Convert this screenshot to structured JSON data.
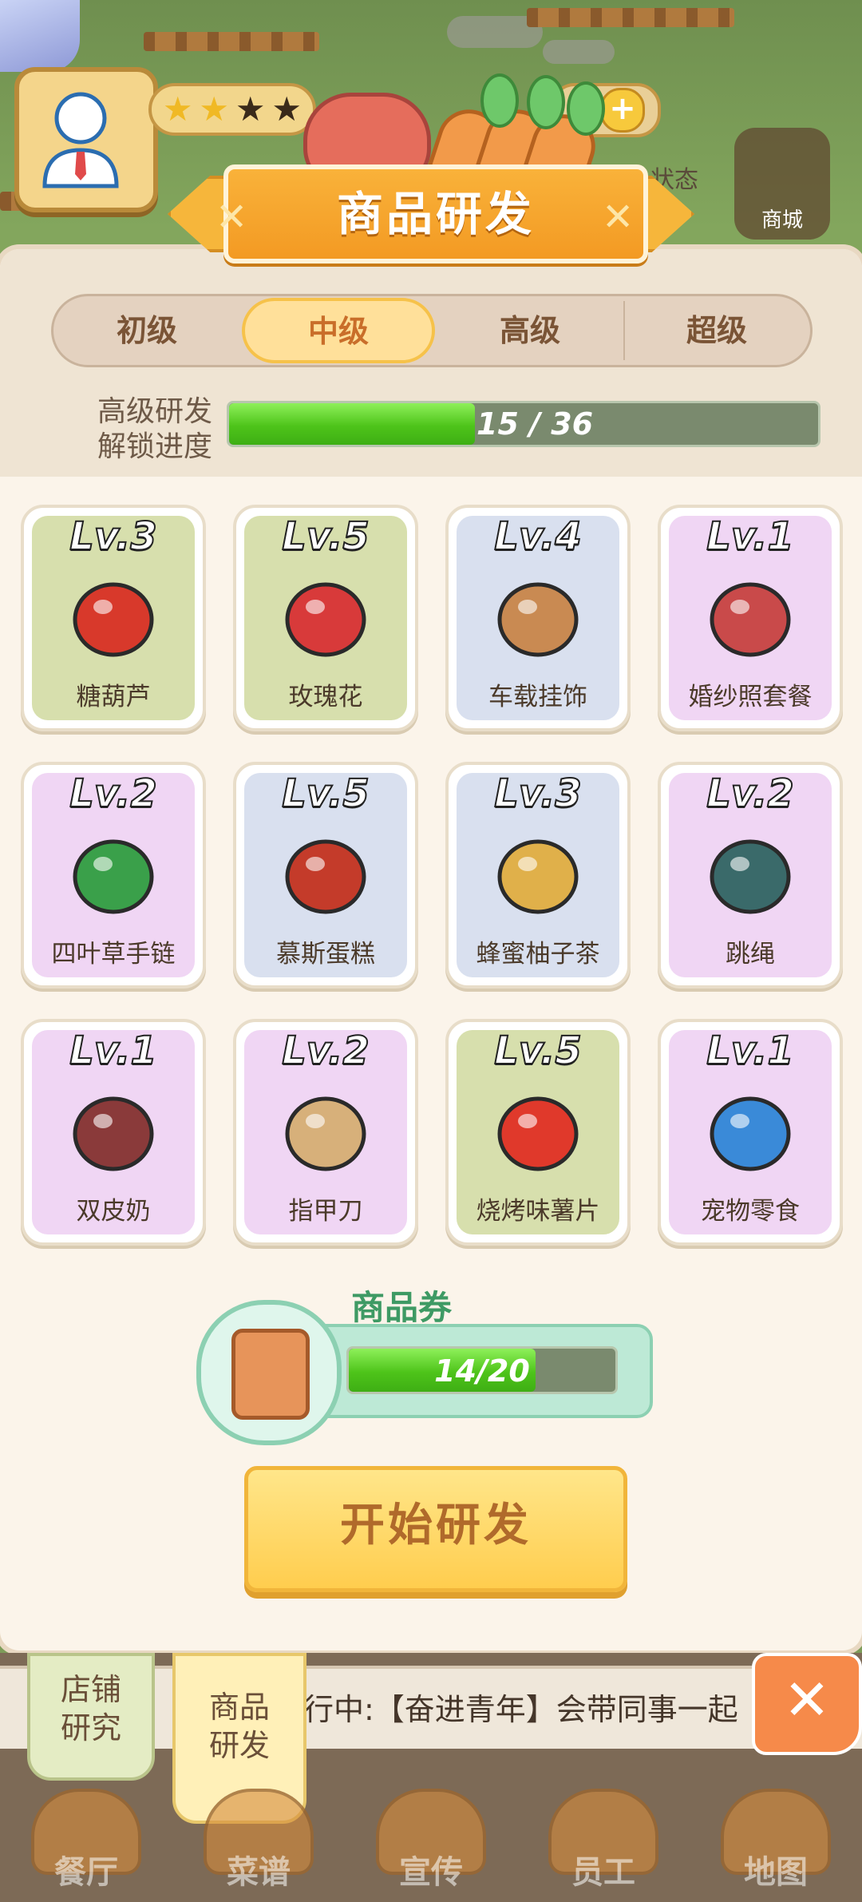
{
  "header": {
    "stars": [
      "★",
      "★",
      "★",
      "★"
    ],
    "shop_label": "商城",
    "status_text": "状态"
  },
  "panel": {
    "title": "商品研发",
    "tabs": [
      {
        "label": "初级",
        "active": false
      },
      {
        "label": "中级",
        "active": true
      },
      {
        "label": "高级",
        "active": false
      },
      {
        "label": "超级",
        "active": false
      }
    ],
    "unlock": {
      "label_line1": "高级研发",
      "label_line2": "解锁进度",
      "current": 15,
      "total": 36,
      "text": "15 / 36"
    },
    "items": [
      {
        "level": "Lv.3",
        "name": "糖葫芦",
        "theme": "green"
      },
      {
        "level": "Lv.5",
        "name": "玫瑰花",
        "theme": "green"
      },
      {
        "level": "Lv.4",
        "name": "车载挂饰",
        "theme": "blue"
      },
      {
        "level": "Lv.1",
        "name": "婚纱照套餐",
        "theme": "purple"
      },
      {
        "level": "Lv.2",
        "name": "四叶草手链",
        "theme": "purple"
      },
      {
        "level": "Lv.5",
        "name": "慕斯蛋糕",
        "theme": "blue"
      },
      {
        "level": "Lv.3",
        "name": "蜂蜜柚子茶",
        "theme": "blue"
      },
      {
        "level": "Lv.2",
        "name": "跳绳",
        "theme": "purple"
      },
      {
        "level": "Lv.1",
        "name": "双皮奶",
        "theme": "purple"
      },
      {
        "level": "Lv.2",
        "name": "指甲刀",
        "theme": "purple"
      },
      {
        "level": "Lv.5",
        "name": "烧烤味薯片",
        "theme": "green"
      },
      {
        "level": "Lv.1",
        "name": "宠物零食",
        "theme": "purple"
      }
    ],
    "voucher": {
      "title": "商品券",
      "current": 14,
      "total": 20,
      "text": "14/20"
    },
    "start_button": "开始研发"
  },
  "bottom": {
    "side_tabs": [
      {
        "line1": "店铺",
        "line2": "研究"
      },
      {
        "line1": "商品",
        "line2": "研发"
      }
    ],
    "ticker": "行中:【奋进青年】会带同事一起",
    "nav": [
      "餐厅",
      "菜谱",
      "宣传",
      "员工",
      "地图"
    ]
  }
}
